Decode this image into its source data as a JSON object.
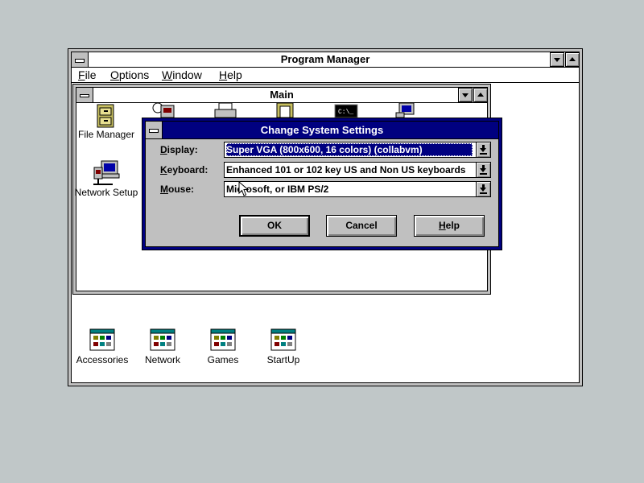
{
  "program_manager": {
    "title": "Program Manager",
    "menu": [
      "File",
      "Options",
      "Window",
      "Help"
    ]
  },
  "main_group": {
    "title": "Main",
    "icons": [
      {
        "label": "File Manager",
        "icon": "file-cabinet-icon"
      },
      {
        "label": "Network Setup",
        "icon": "network-computer-icon"
      }
    ]
  },
  "group_icons": [
    {
      "label": "Accessories",
      "icon": "program-group-icon"
    },
    {
      "label": "Network",
      "icon": "program-group-icon"
    },
    {
      "label": "Games",
      "icon": "program-group-icon"
    },
    {
      "label": "StartUp",
      "icon": "program-group-icon"
    }
  ],
  "dialog": {
    "title": "Change System Settings",
    "fields": [
      {
        "label": "Display:",
        "value": "Super VGA (800x600, 16 colors) (collabvm)"
      },
      {
        "label": "Keyboard:",
        "value": "Enhanced 101 or 102 key US and Non US keyboards"
      },
      {
        "label": "Mouse:",
        "value": "Microsoft, or IBM PS/2"
      }
    ],
    "buttons": {
      "ok": "OK",
      "cancel": "Cancel",
      "help": "Help"
    }
  },
  "colors": {
    "desktop": "#c0c7c8",
    "title_active": "#000080",
    "face": "#c0c0c0"
  }
}
